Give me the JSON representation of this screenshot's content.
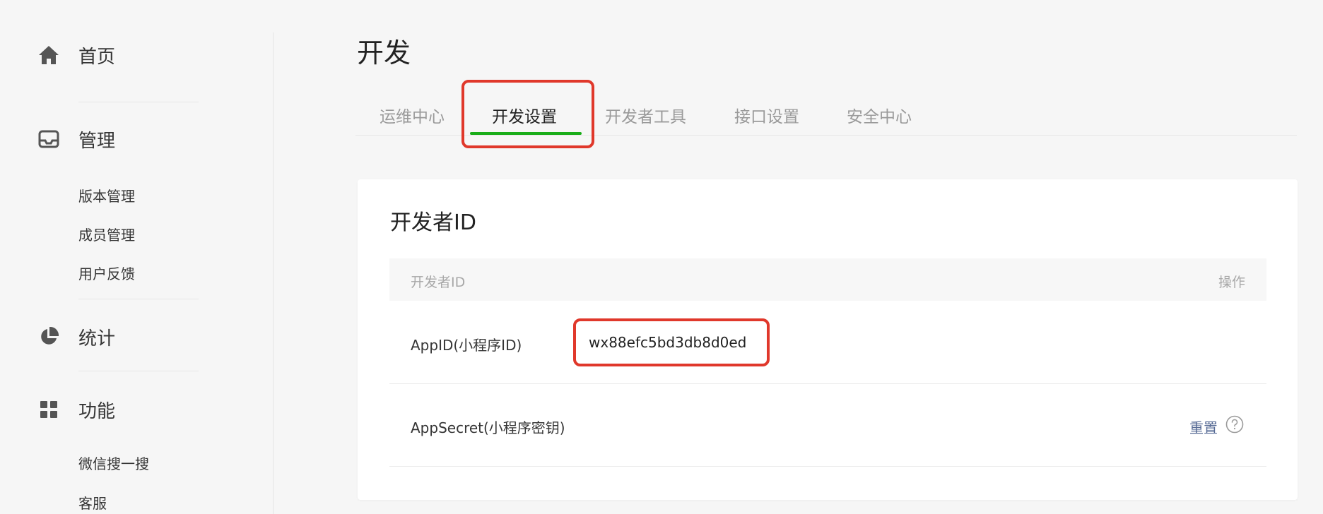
{
  "sidebar": {
    "home": {
      "label": "首页",
      "icon": "home-icon"
    },
    "manage": {
      "label": "管理",
      "icon": "inbox-icon",
      "items": [
        {
          "label": "版本管理"
        },
        {
          "label": "成员管理"
        },
        {
          "label": "用户反馈"
        }
      ]
    },
    "stats": {
      "label": "统计",
      "icon": "pie-chart-icon"
    },
    "features": {
      "label": "功能",
      "icon": "grid-icon",
      "items": [
        {
          "label": "微信搜一搜"
        },
        {
          "label": "客服"
        }
      ]
    }
  },
  "page": {
    "title": "开发"
  },
  "tabs": [
    {
      "label": "运维中心",
      "active": false
    },
    {
      "label": "开发设置",
      "active": true
    },
    {
      "label": "开发者工具",
      "active": false
    },
    {
      "label": "接口设置",
      "active": false
    },
    {
      "label": "安全中心",
      "active": false
    }
  ],
  "card": {
    "title": "开发者ID",
    "table": {
      "headers": {
        "name": "开发者ID",
        "action": "操作"
      },
      "rows": [
        {
          "label": "AppID(小程序ID)",
          "value": "wx88efc5bd3db8d0ed"
        },
        {
          "label": "AppSecret(小程序密钥)",
          "action": "重置"
        }
      ]
    }
  },
  "colors": {
    "accent_green": "#1aad19",
    "highlight_red": "#e0382b",
    "link_blue": "#576b95"
  }
}
